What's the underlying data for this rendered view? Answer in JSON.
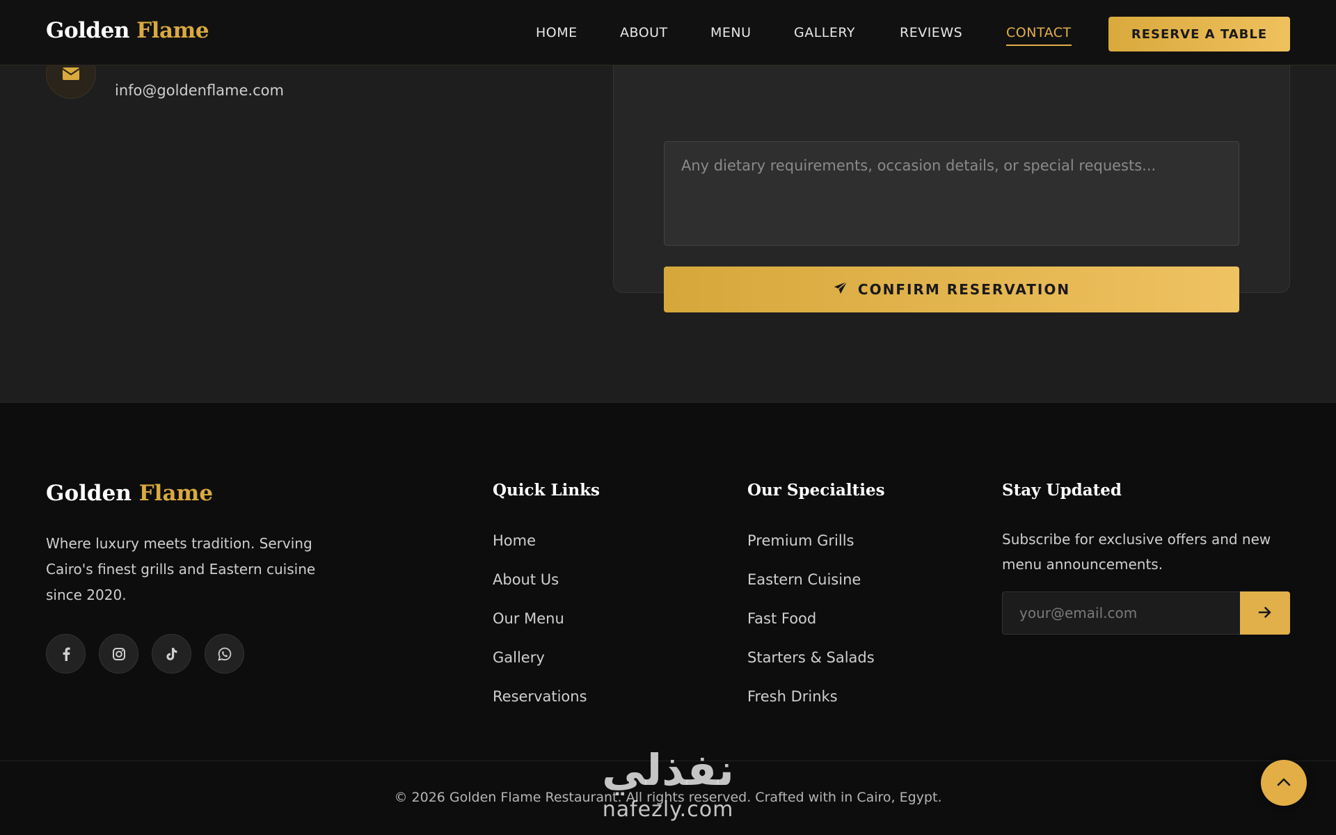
{
  "navbar": {
    "brand_first": "Golden",
    "brand_second": "Flame",
    "links": [
      "HOME",
      "ABOUT",
      "MENU",
      "GALLERY",
      "REVIEWS",
      "CONTACT"
    ],
    "active_link": "CONTACT",
    "reserve_label": "RESERVE A TABLE"
  },
  "contact": {
    "email_icon": "envelope-icon",
    "email": "info@goldenflame.com"
  },
  "form": {
    "notes_placeholder": "Any dietary requirements, occasion details, or special requests...",
    "confirm_icon": "paper-plane-icon",
    "confirm_label": "CONFIRM RESERVATION"
  },
  "footer": {
    "brand_first": "Golden",
    "brand_second": "Flame",
    "description": "Where luxury meets tradition. Serving Cairo's finest grills and Eastern cuisine since 2020.",
    "socials": [
      "facebook-icon",
      "instagram-icon",
      "tiktok-icon",
      "whatsapp-icon"
    ],
    "quick_links": {
      "title": "Quick Links",
      "items": [
        "Home",
        "About Us",
        "Our Menu",
        "Gallery",
        "Reservations"
      ]
    },
    "specialties": {
      "title": "Our Specialties",
      "items": [
        "Premium Grills",
        "Eastern Cuisine",
        "Fast Food",
        "Starters & Salads",
        "Fresh Drinks"
      ]
    },
    "newsletter": {
      "title": "Stay Updated",
      "text": "Subscribe for exclusive offers and new menu announcements.",
      "email_placeholder": "your@email.com",
      "submit_icon": "arrow-right-icon"
    },
    "copyright": "© 2026 Golden Flame Restaurant. All rights reserved. Crafted with in Cairo, Egypt."
  },
  "watermark": {
    "arabic": "نفذلي",
    "latin": "nafezly.com"
  },
  "back_to_top_icon": "chevron-up-icon",
  "colors": {
    "accent": "#e2b04a",
    "background": "#1e1e1e",
    "footer_background": "#0d0d0d"
  }
}
